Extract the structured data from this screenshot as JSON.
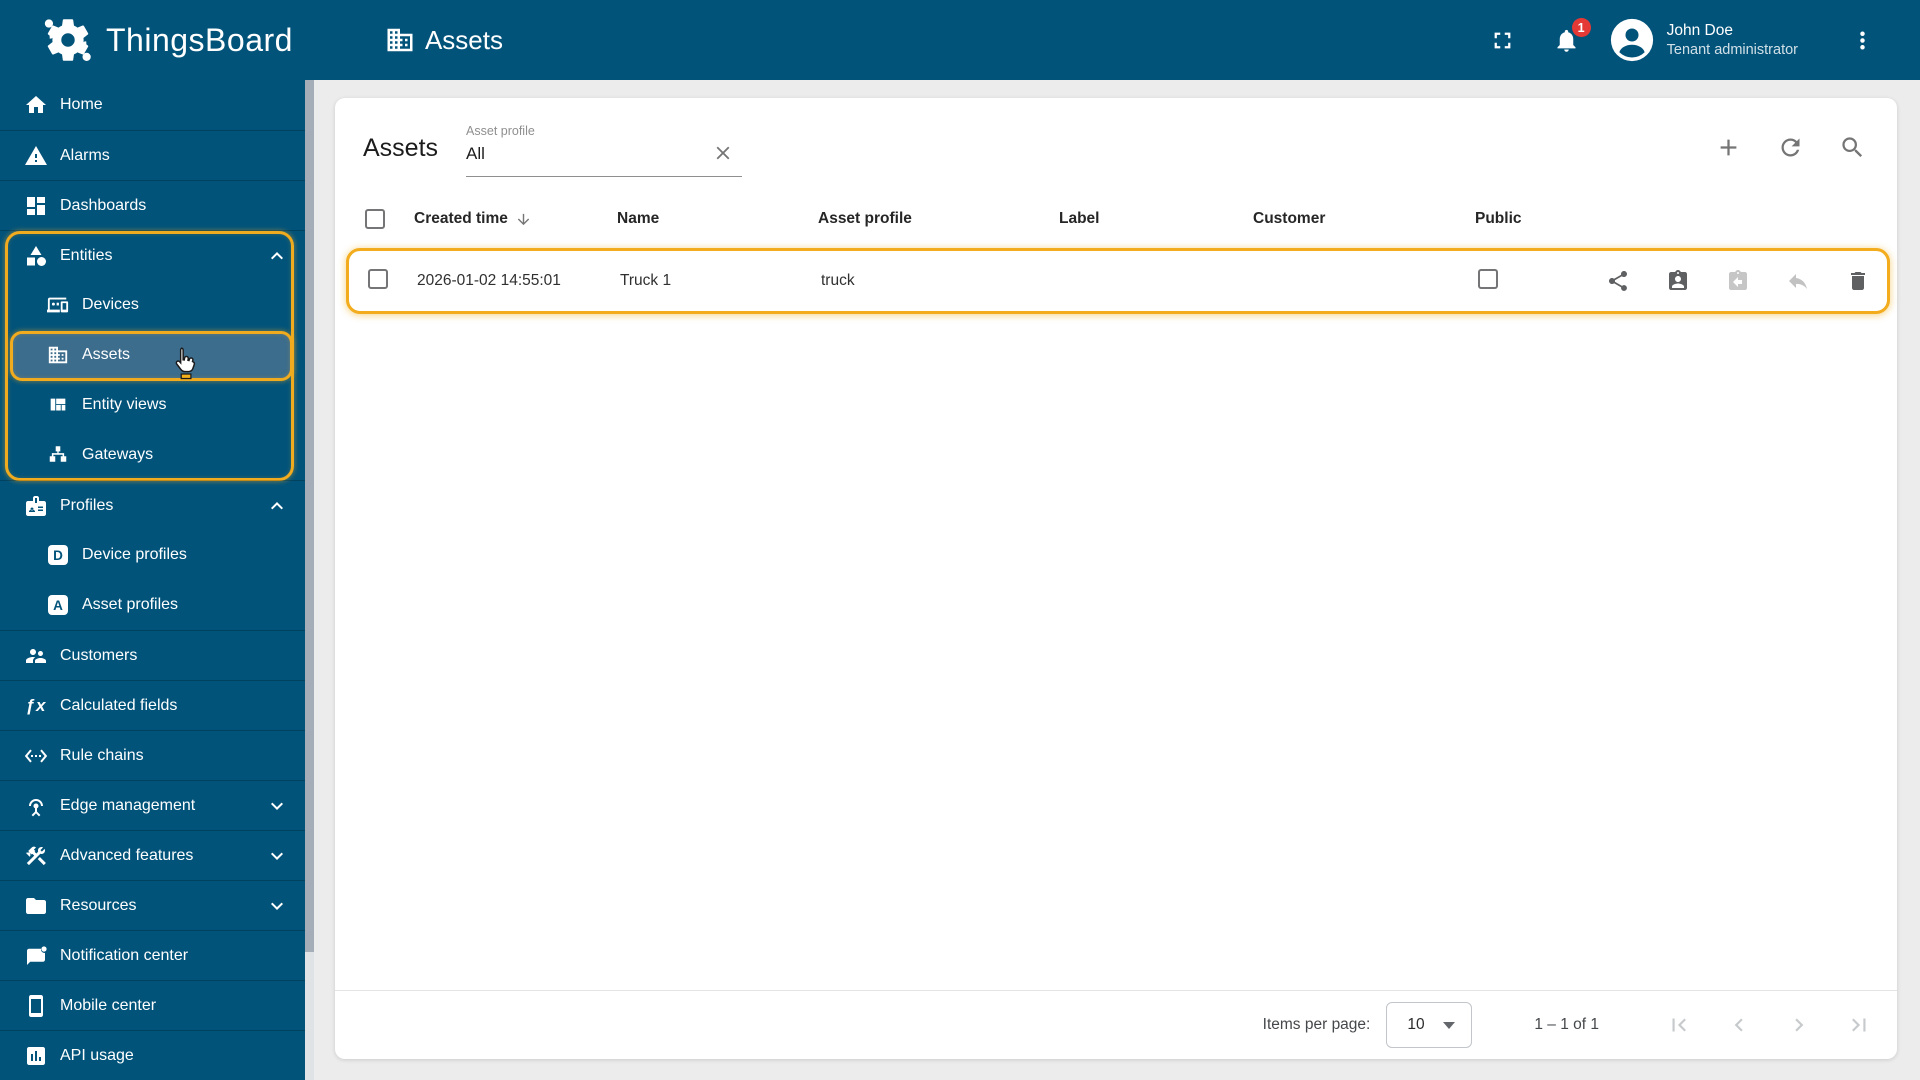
{
  "header": {
    "logo_text": "ThingsBoard",
    "page_title": "Assets",
    "notification_count": "1",
    "user": {
      "name": "John Doe",
      "role": "Tenant administrator"
    }
  },
  "sidebar": {
    "items": [
      {
        "label": "Home",
        "icon": "home-icon"
      },
      {
        "label": "Alarms",
        "icon": "alarms-icon"
      },
      {
        "label": "Dashboards",
        "icon": "dashboards-icon"
      },
      {
        "label": "Entities",
        "icon": "entities-icon",
        "expanded": true
      },
      {
        "label": "Devices",
        "icon": "devices-icon"
      },
      {
        "label": "Assets",
        "icon": "assets-icon",
        "selected": true
      },
      {
        "label": "Entity views",
        "icon": "entity-views-icon"
      },
      {
        "label": "Gateways",
        "icon": "gateways-icon"
      },
      {
        "label": "Profiles",
        "icon": "profiles-icon",
        "expanded": true
      },
      {
        "label": "Device profiles",
        "icon": "device-profiles-icon"
      },
      {
        "label": "Asset profiles",
        "icon": "asset-profiles-icon"
      },
      {
        "label": "Customers",
        "icon": "customers-icon"
      },
      {
        "label": "Calculated fields",
        "icon": "calculated-fields-icon"
      },
      {
        "label": "Rule chains",
        "icon": "rule-chains-icon"
      },
      {
        "label": "Edge management",
        "icon": "edge-management-icon",
        "collapsed": true
      },
      {
        "label": "Advanced features",
        "icon": "advanced-features-icon",
        "collapsed": true
      },
      {
        "label": "Resources",
        "icon": "resources-icon",
        "collapsed": true
      },
      {
        "label": "Notification center",
        "icon": "notification-center-icon"
      },
      {
        "label": "Mobile center",
        "icon": "mobile-center-icon"
      },
      {
        "label": "API usage",
        "icon": "api-usage-icon"
      }
    ],
    "icon_glyphs": {
      "device_profile_letter": "D",
      "asset_profile_letter": "A",
      "calculated_fields_glyph": "ƒx"
    }
  },
  "content": {
    "title": "Assets",
    "filter": {
      "label": "Asset profile",
      "value": "All"
    },
    "table": {
      "columns": [
        "Created time",
        "Name",
        "Asset profile",
        "Label",
        "Customer",
        "Public"
      ],
      "sort_column": "Created time",
      "sort_direction": "descending",
      "rows": [
        {
          "created_time": "2026-01-02 14:55:01",
          "name": "Truck 1",
          "asset_profile": "truck",
          "label": "",
          "customer": "",
          "public": false
        }
      ]
    },
    "pagination": {
      "items_per_page_label": "Items per page:",
      "page_size": "10",
      "range_label": "1 – 1 of 1"
    }
  },
  "colors": {
    "primary": "#02537a",
    "selected_item": "#3c6d8d",
    "highlight_accent": "#f2ac1d",
    "badge_red": "#e53935",
    "main_background": "#ececec"
  }
}
